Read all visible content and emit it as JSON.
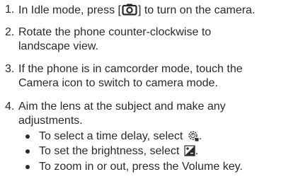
{
  "steps": [
    {
      "number": "1.",
      "before_icon": "In Idle mode, press [",
      "icon": "camera-key-icon",
      "after_icon": "] to turn on the camera."
    },
    {
      "number": "2.",
      "line1": "Rotate the phone counter-clockwise to",
      "line2": "landscape view."
    },
    {
      "number": "3.",
      "line1": "If the phone is in camcorder mode, touch the",
      "line2": "Camera icon to switch to camera mode."
    },
    {
      "number": "4.",
      "line1": "Aim the lens at the subject and make any",
      "line2": "adjustments."
    }
  ],
  "bullets": [
    {
      "text": "To select a time delay, select",
      "icon": "timer-icon",
      "suffix": "."
    },
    {
      "text": "To set the brightness, select",
      "icon": "brightness-icon",
      "suffix": "."
    },
    {
      "text": "To zoom in or out, press the Volume key.",
      "icon": "",
      "suffix": ""
    }
  ]
}
